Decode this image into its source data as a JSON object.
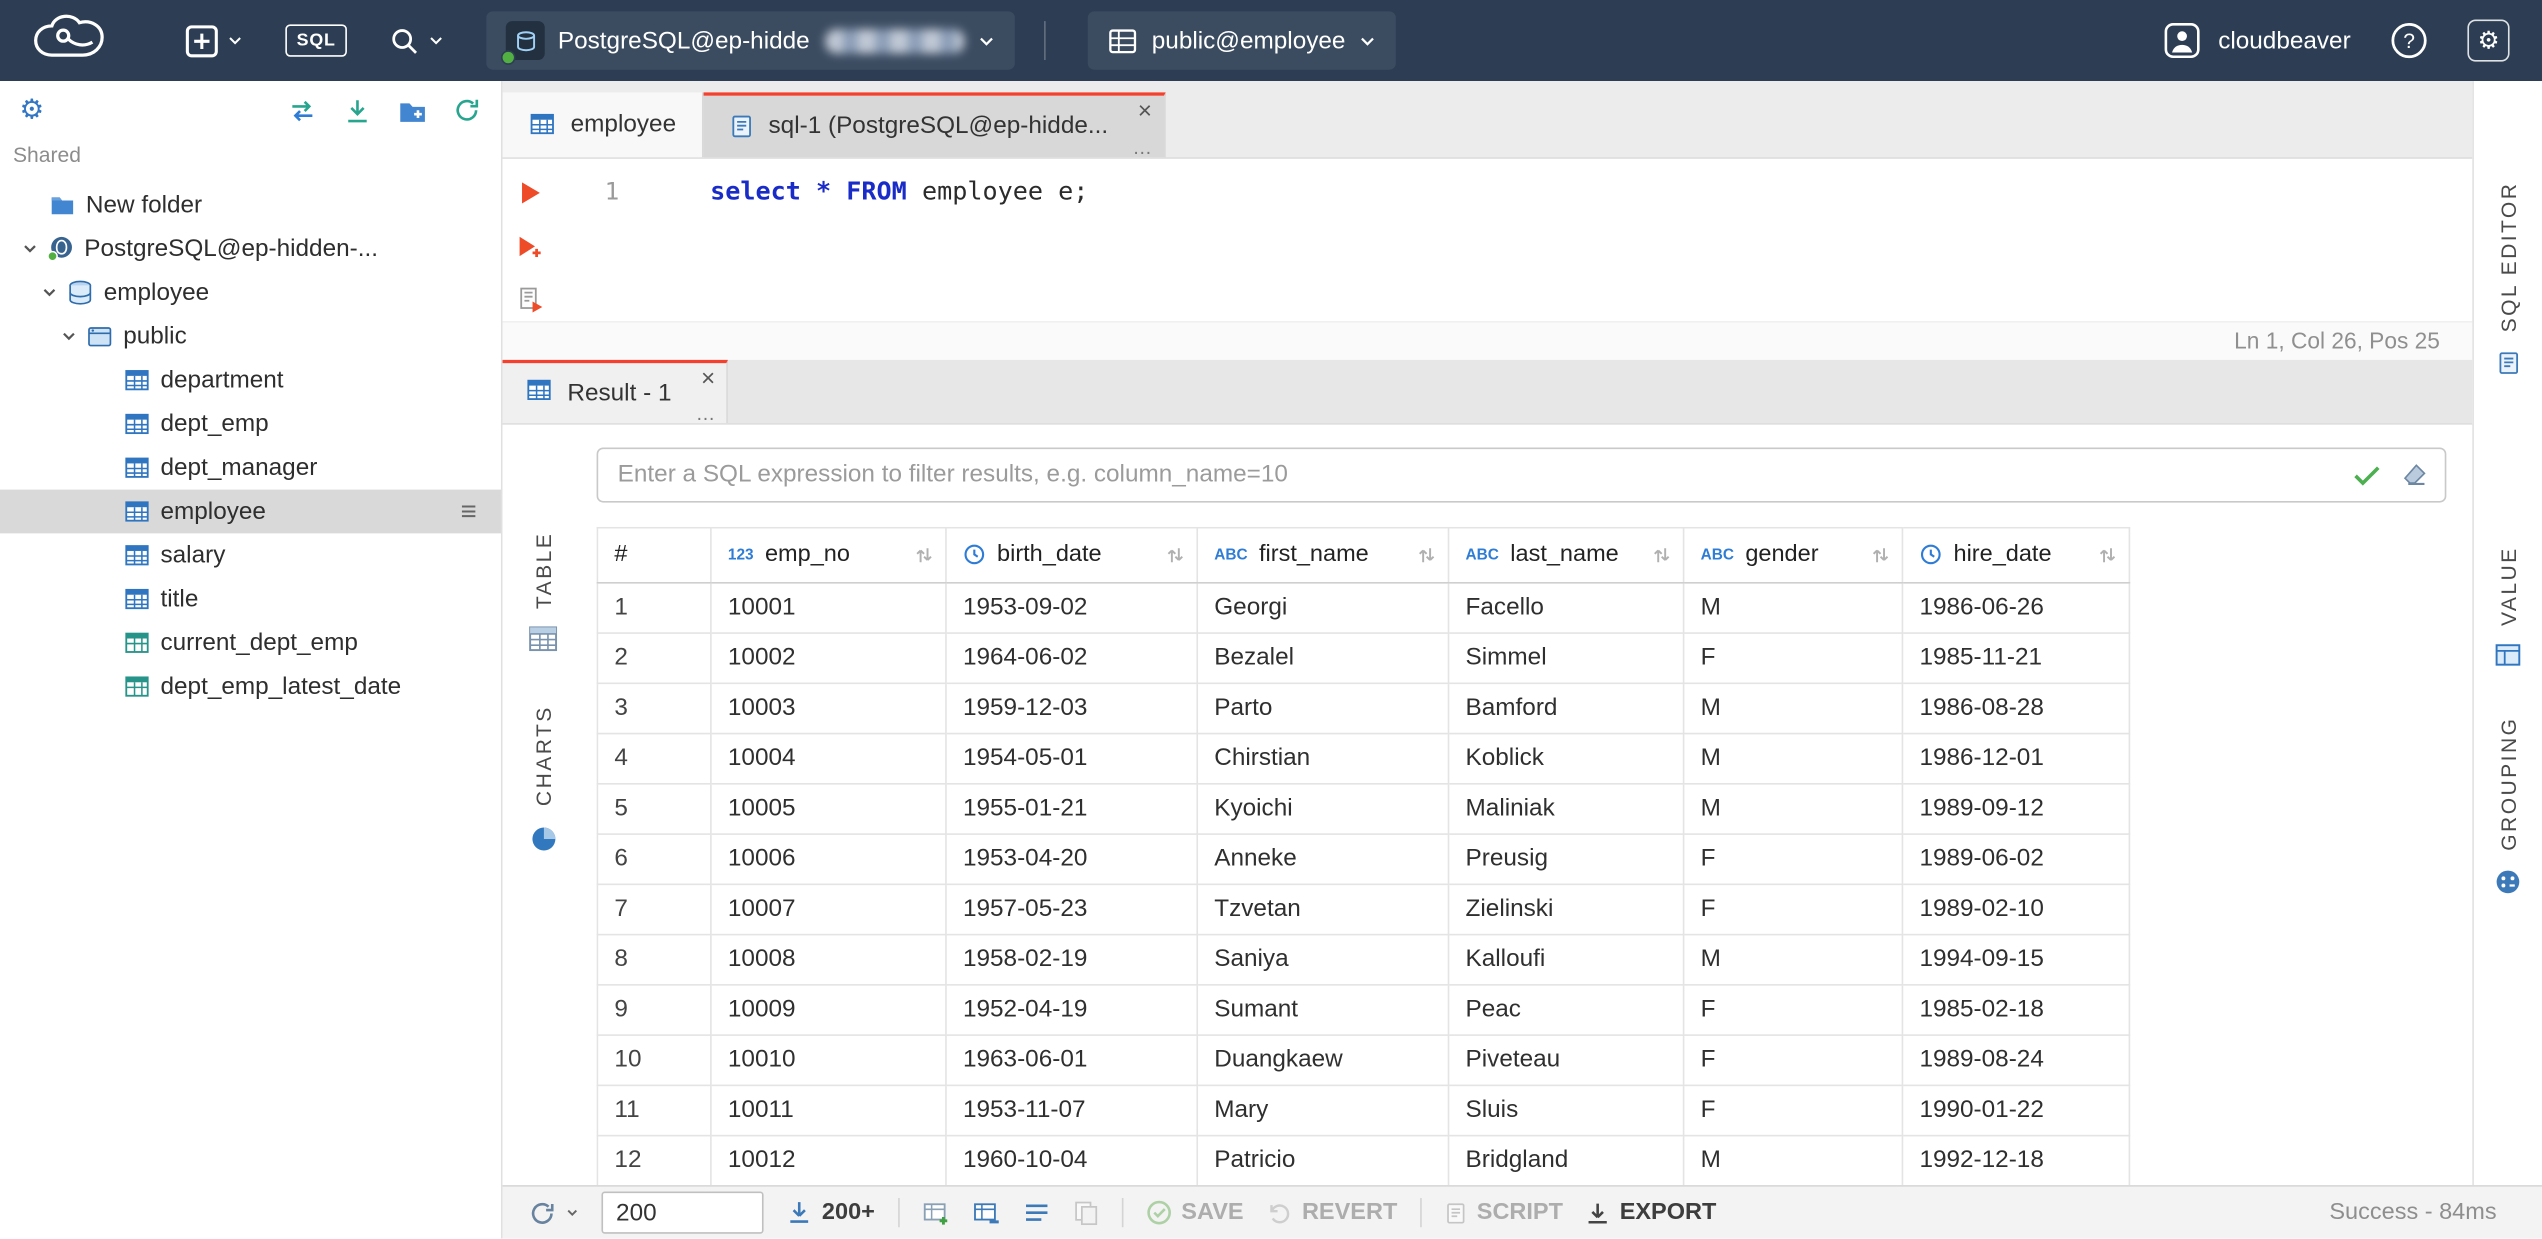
{
  "topbar": {
    "sql_button": "SQL",
    "connection_label": "PostgreSQL@ep-hidde",
    "schema_label": "public@employee",
    "user_name": "cloudbeaver"
  },
  "sidebar": {
    "section_label": "Shared",
    "tree": [
      {
        "label": "New folder",
        "type": "folder"
      },
      {
        "label": "PostgreSQL@ep-hidden-...",
        "type": "connection",
        "expanded": true
      },
      {
        "label": "employee",
        "type": "database",
        "expanded": true
      },
      {
        "label": "public",
        "type": "schema",
        "expanded": true
      },
      {
        "label": "department",
        "type": "table"
      },
      {
        "label": "dept_emp",
        "type": "table"
      },
      {
        "label": "dept_manager",
        "type": "table"
      },
      {
        "label": "employee",
        "type": "table",
        "selected": true
      },
      {
        "label": "salary",
        "type": "table"
      },
      {
        "label": "title",
        "type": "table"
      },
      {
        "label": "current_dept_emp",
        "type": "view"
      },
      {
        "label": "dept_emp_latest_date",
        "type": "view"
      }
    ]
  },
  "editor_tabs": [
    {
      "label": "employee"
    },
    {
      "label": "sql-1 (PostgreSQL@ep-hidde..."
    }
  ],
  "sql_editor": {
    "line_number": "1",
    "code_tokens": [
      {
        "text": "select",
        "kind": "keyword"
      },
      {
        "text": " ",
        "kind": "plain"
      },
      {
        "text": "*",
        "kind": "keyword"
      },
      {
        "text": " ",
        "kind": "plain"
      },
      {
        "text": "FROM",
        "kind": "keyword"
      },
      {
        "text": " employee e;",
        "kind": "plain"
      }
    ],
    "status": "Ln 1, Col 26, Pos 25",
    "panel_label": "SQL EDITOR"
  },
  "result_panel": {
    "tab_label": "Result - 1",
    "filter_placeholder": "Enter a SQL expression to filter results, e.g. column_name=10",
    "left_tabs": [
      "TABLE",
      "CHARTS"
    ],
    "right_tabs": [
      "VALUE",
      "GROUPING"
    ]
  },
  "grid": {
    "columns": [
      {
        "name": "#",
        "kind": "index"
      },
      {
        "name": "emp_no",
        "kind": "number"
      },
      {
        "name": "birth_date",
        "kind": "date"
      },
      {
        "name": "first_name",
        "kind": "text"
      },
      {
        "name": "last_name",
        "kind": "text"
      },
      {
        "name": "gender",
        "kind": "text"
      },
      {
        "name": "hire_date",
        "kind": "date"
      }
    ],
    "rows": [
      [
        "1",
        "10001",
        "1953-09-02",
        "Georgi",
        "Facello",
        "M",
        "1986-06-26"
      ],
      [
        "2",
        "10002",
        "1964-06-02",
        "Bezalel",
        "Simmel",
        "F",
        "1985-11-21"
      ],
      [
        "3",
        "10003",
        "1959-12-03",
        "Parto",
        "Bamford",
        "M",
        "1986-08-28"
      ],
      [
        "4",
        "10004",
        "1954-05-01",
        "Chirstian",
        "Koblick",
        "M",
        "1986-12-01"
      ],
      [
        "5",
        "10005",
        "1955-01-21",
        "Kyoichi",
        "Maliniak",
        "M",
        "1989-09-12"
      ],
      [
        "6",
        "10006",
        "1953-04-20",
        "Anneke",
        "Preusig",
        "F",
        "1989-06-02"
      ],
      [
        "7",
        "10007",
        "1957-05-23",
        "Tzvetan",
        "Zielinski",
        "F",
        "1989-02-10"
      ],
      [
        "8",
        "10008",
        "1958-02-19",
        "Saniya",
        "Kalloufi",
        "M",
        "1994-09-15"
      ],
      [
        "9",
        "10009",
        "1952-04-19",
        "Sumant",
        "Peac",
        "F",
        "1985-02-18"
      ],
      [
        "10",
        "10010",
        "1963-06-01",
        "Duangkaew",
        "Piveteau",
        "F",
        "1989-08-24"
      ],
      [
        "11",
        "10011",
        "1953-11-07",
        "Mary",
        "Sluis",
        "F",
        "1990-01-22"
      ],
      [
        "12",
        "10012",
        "1960-10-04",
        "Patricio",
        "Bridgland",
        "M",
        "1992-12-18"
      ]
    ]
  },
  "bottom_toolbar": {
    "fetch_size": "200",
    "fetch_more_label": "200+",
    "save_label": "SAVE",
    "revert_label": "REVERT",
    "script_label": "SCRIPT",
    "export_label": "EXPORT",
    "status": "Success - 84ms"
  }
}
